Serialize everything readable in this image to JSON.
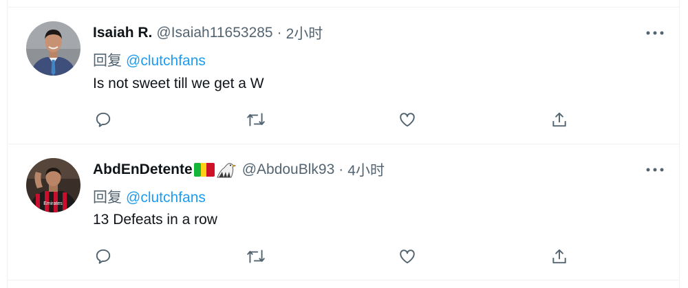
{
  "tweets": [
    {
      "display_name": "Isaiah R.",
      "handle": "@Isaiah11653285",
      "separator": "·",
      "time": "2小时",
      "reply_prefix": "回复",
      "reply_mention": "@clutchfans",
      "text": "Is not sweet till we get a W",
      "avatar": "profile photo of a smiling man in a suit and blue tie"
    },
    {
      "display_name": "AbdEnDetente",
      "name_emojis": [
        "mali-flag-emoji",
        "eagle-emoji"
      ],
      "handle": "@AbdouBlk93",
      "separator": "·",
      "time": "4小时",
      "reply_prefix": "回复",
      "reply_mention": "@clutchfans",
      "text": "13 Defeats in a row",
      "avatar": "photo of a soccer player in a red and black striped jersey"
    }
  ],
  "icons": [
    "more-options-icon",
    "reply-icon",
    "retweet-icon",
    "like-icon",
    "share-icon"
  ],
  "colors": {
    "text_primary": "#0f1419",
    "text_secondary": "#536471",
    "accent_blue": "#1d9bf0",
    "divider": "#eff3f4"
  }
}
